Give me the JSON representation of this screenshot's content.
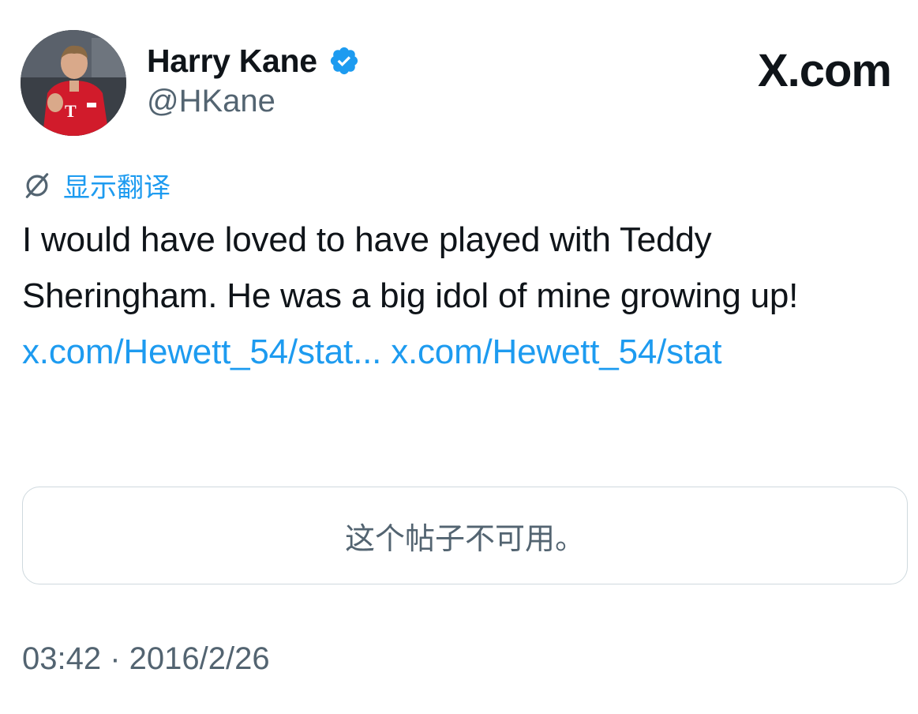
{
  "author": {
    "display_name": "Harry Kane",
    "handle": "@HKane",
    "verified": true,
    "avatar_icon": "player-photo"
  },
  "brand": {
    "label": "X.com"
  },
  "translate": {
    "icon": "globe-slash-icon",
    "label": "显示翻译"
  },
  "tweet": {
    "text_1": "I would have loved to have played with Teddy Sheringham. He was a big idol of mine growing up!",
    "link_1": "x.com/Hewett_54/stat...",
    "link_2": "x.com/Hewett_54/stat"
  },
  "quoted_post": {
    "message": "这个帖子不可用。"
  },
  "meta": {
    "timestamp": "03:42 · 2016/2/26"
  },
  "colors": {
    "link": "#1d9bf0",
    "secondary_text": "#536471",
    "primary_text": "#0f1419",
    "border": "#cfd9de",
    "verified_badge": "#1d9bf0"
  }
}
